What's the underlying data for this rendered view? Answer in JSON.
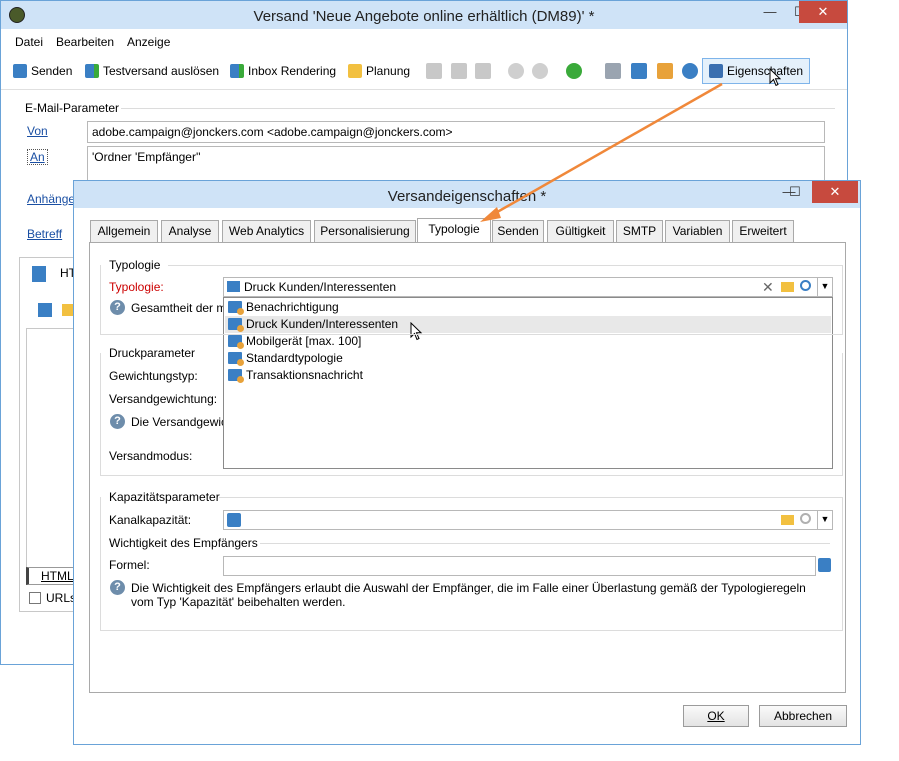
{
  "main_window": {
    "title": "Versand 'Neue Angebote online erhältlich (DM89)' *",
    "minimize": "—",
    "maximize": "☐",
    "close": "✕",
    "menu": [
      "Datei",
      "Bearbeiten",
      "Anzeige"
    ],
    "toolbar": {
      "send": "Senden",
      "proof": "Testversand auslösen",
      "inbox": "Inbox Rendering",
      "schedule": "Planung",
      "properties": "Eigenschaften"
    },
    "email_params_legend": "E-Mail-Parameter",
    "from_label": "Von",
    "from_value": "adobe.campaign@jonckers.com <adobe.campaign@jonckers.com>",
    "to_label": "An",
    "to_value": "'Ordner 'Empfänger''",
    "attachments_label": "Anhänge",
    "subject_label": "Betreff",
    "bottom_tab": "HTML",
    "bottom_tab_short": "HT",
    "urls_checkbox": "URLs"
  },
  "dialog": {
    "title": "Versandeigenschaften *",
    "minimize": "—",
    "maximize": "☐",
    "close": "✕",
    "tabs": [
      "Allgemein",
      "Analyse",
      "Web Analytics",
      "Personalisierung",
      "Typologie",
      "Senden",
      "Gültigkeit",
      "SMTP",
      "Variablen",
      "Erweitert"
    ],
    "selected_tab": "Typologie",
    "typology_legend": "Typologie",
    "typology_label": "Typologie:",
    "typology_value": "Druck Kunden/Interessenten",
    "typology_help": "Gesamtheit der m",
    "dropdown_items": [
      "Benachrichtigung",
      "Druck Kunden/Interessenten",
      "Mobilgerät [max. 100]",
      "Standardtypologie",
      "Transaktionsnachricht"
    ],
    "hovered_item": "Druck Kunden/Interessenten",
    "print_legend": "Druckparameter",
    "weighting_type": "Gewichtungstyp:",
    "delivery_weighting": "Versandgewichtung:",
    "weighting_help": "Die Versandgewic",
    "delivery_mode": "Versandmodus:",
    "capacity_legend": "Kapazitätsparameter",
    "channel_capacity": "Kanalkapazität:",
    "recipient_importance": "Wichtigkeit des Empfängers",
    "formula_label": "Formel:",
    "importance_help": "Die Wichtigkeit des Empfängers erlaubt die Auswahl der Empfänger, die im Falle einer Überlastung gemäß der Typologieregeln vom Typ 'Kapazität' beibehalten werden.",
    "ok": "OK",
    "cancel": "Abbrechen"
  },
  "colors": {
    "titlebar": "#cfe3f7",
    "border": "#6aa3d8",
    "required_label": "#cc0000",
    "link": "#1a4fa3",
    "arrow": "#f0883a",
    "hover_row": "#e8e8e8"
  }
}
